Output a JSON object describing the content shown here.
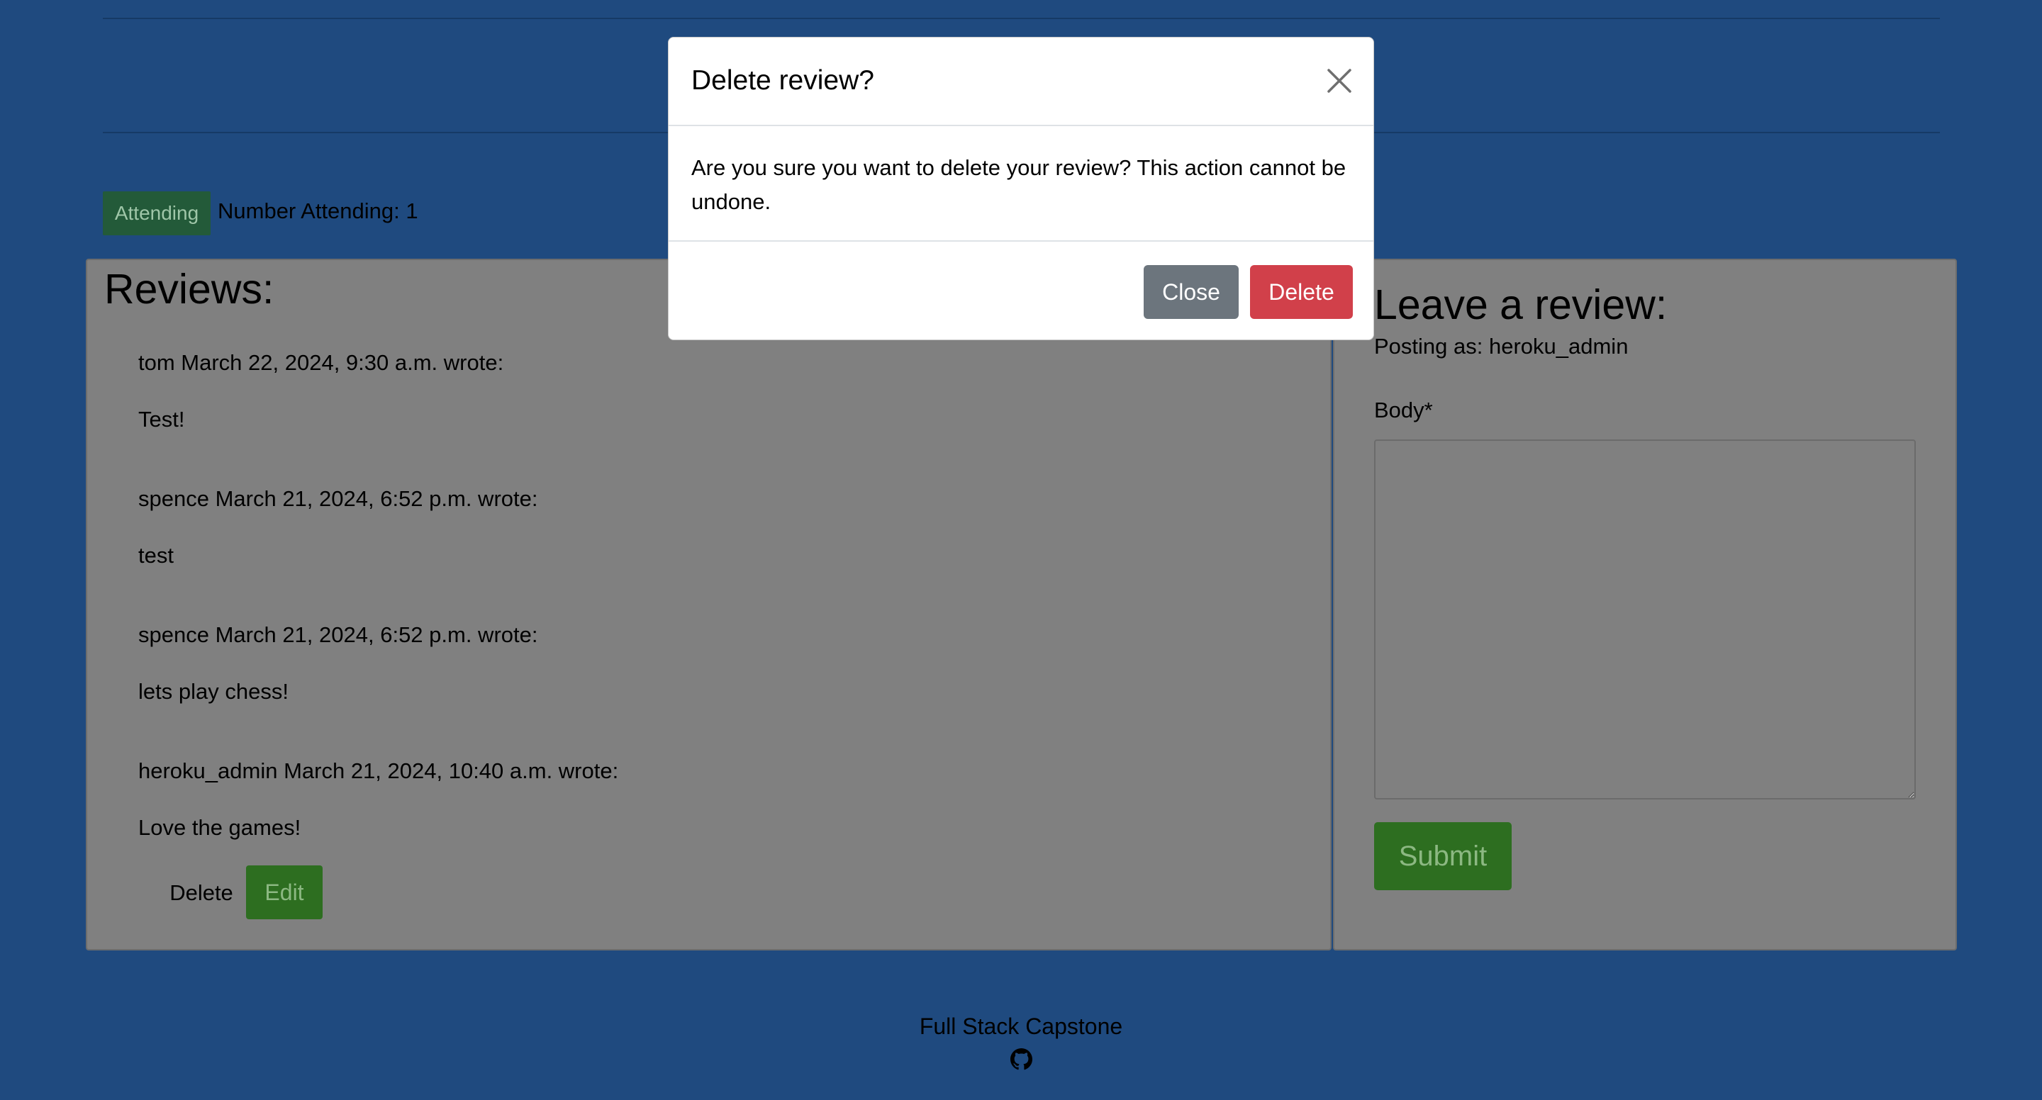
{
  "event": {
    "attending_badge": "Attending",
    "attending_count": "Number Attending: 1"
  },
  "reviews": {
    "heading": "Reviews:",
    "items": [
      {
        "meta": "tom March 22, 2024, 9:30 a.m. wrote:",
        "body": "Test!"
      },
      {
        "meta": "spence March 21, 2024, 6:52 p.m. wrote:",
        "body": "test"
      },
      {
        "meta": "spence March 21, 2024, 6:52 p.m. wrote:",
        "body": "lets play chess!"
      },
      {
        "meta": "heroku_admin March 21, 2024, 10:40 a.m. wrote:",
        "body": "Love the games!"
      }
    ],
    "delete_label": "Delete",
    "edit_label": "Edit"
  },
  "review_form": {
    "heading": "Leave a review:",
    "posting_as": "Posting as: heroku_admin",
    "body_label": "Body*",
    "body_value": "",
    "submit_label": "Submit"
  },
  "footer": {
    "text": "Full Stack Capstone",
    "icon": "github-icon"
  },
  "modal": {
    "title": "Delete review?",
    "body": "Are you sure you want to delete your review? This action cannot be undone.",
    "close_label": "Close",
    "delete_label": "Delete",
    "close_icon": "close-icon"
  },
  "colors": {
    "page_background": "#1f4a7f",
    "panel_background": "#808080",
    "success_green": "#2d6e20",
    "danger_red": "#d1404a",
    "secondary_gray": "#6c757d"
  }
}
